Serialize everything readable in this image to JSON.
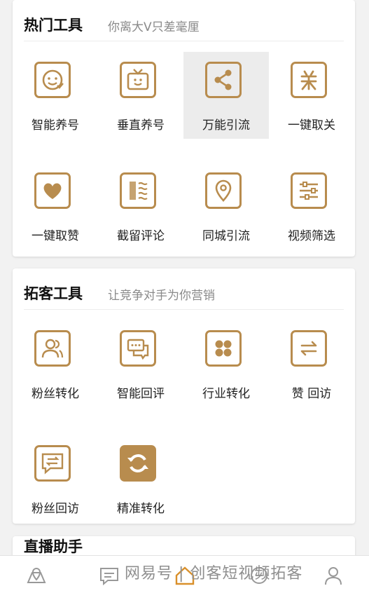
{
  "hot_tools": {
    "title": "热门工具",
    "subtitle": "你离大V只差毫厘",
    "items": [
      {
        "label": "智能养号",
        "icon": "smile-face-icon"
      },
      {
        "label": "垂直养号",
        "icon": "tv-icon"
      },
      {
        "label": "万能引流",
        "icon": "share-icon"
      },
      {
        "label": "一键取关",
        "icon": "unfollow-icon"
      },
      {
        "label": "一键取赞",
        "icon": "heart-icon"
      },
      {
        "label": "截留评论",
        "icon": "comment-intercept-icon"
      },
      {
        "label": "同城引流",
        "icon": "location-pin-icon"
      },
      {
        "label": "视频筛选",
        "icon": "filter-sliders-icon"
      }
    ]
  },
  "acquire_tools": {
    "title": "拓客工具",
    "subtitle": "让竞争对手为你营销",
    "items": [
      {
        "label": "粉丝转化",
        "icon": "users-icon"
      },
      {
        "label": "智能回评",
        "icon": "chat-bubbles-icon"
      },
      {
        "label": "行业转化",
        "icon": "grid-icon"
      },
      {
        "label": "赞 回访",
        "icon": "swap-arrows-icon"
      },
      {
        "label": "粉丝回访",
        "icon": "message-swap-icon"
      },
      {
        "label": "精准转化",
        "icon": "refresh-icon"
      }
    ]
  },
  "next_section_peek": {
    "title": "直播助手"
  },
  "watermark": "网易号 | 创客短视频拓客",
  "bottom_nav": [
    {
      "icon": "map-pin-icon"
    },
    {
      "icon": "message-icon"
    },
    {
      "icon": "home-icon"
    },
    {
      "icon": "chat-icon"
    },
    {
      "icon": "user-icon"
    }
  ],
  "colors": {
    "accent": "#b88c4e",
    "background": "#f2f2f2",
    "card": "#ffffff"
  }
}
